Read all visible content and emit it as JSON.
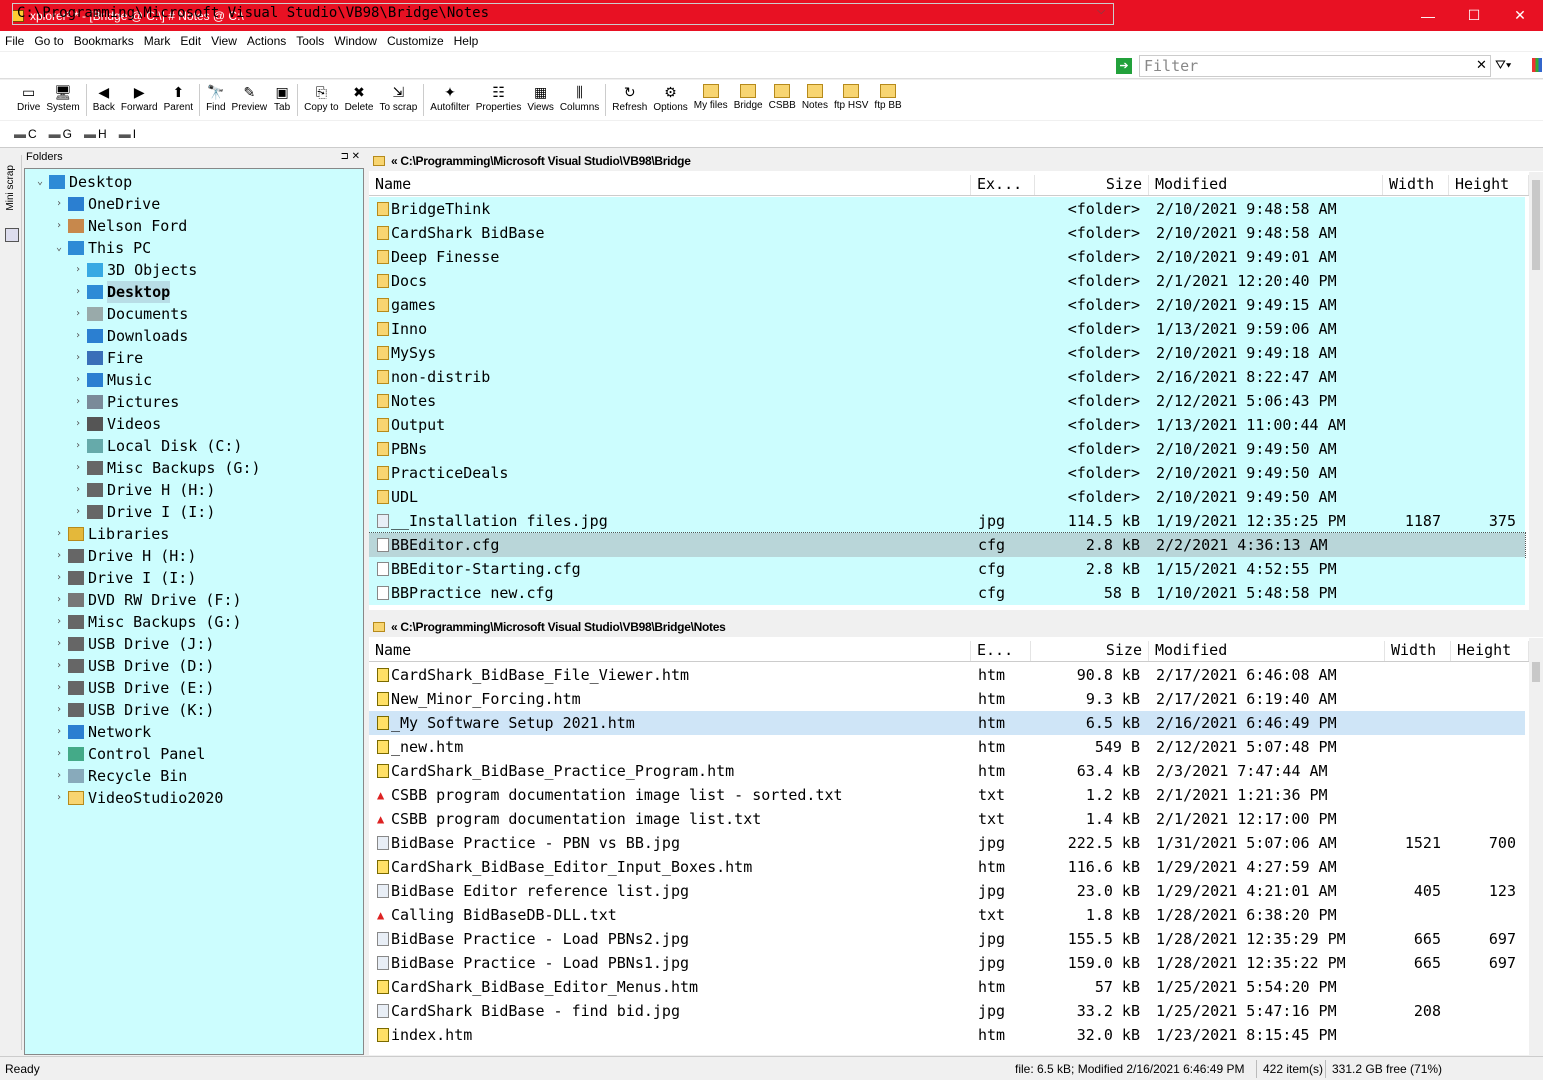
{
  "window": {
    "title": "xplorer² * - [Bridge @ C:\\] # Notes @ C:\\",
    "min": "—",
    "max": "☐",
    "close": "✕"
  },
  "menu": [
    "File",
    "Go to",
    "Bookmarks",
    "Mark",
    "Edit",
    "View",
    "Actions",
    "Tools",
    "Window",
    "Customize",
    "Help"
  ],
  "address": {
    "path": "C:\\Programming\\Microsoft Visual Studio\\VB98\\Bridge\\Notes",
    "filter_placeholder": "Filter"
  },
  "toolbar": [
    {
      "label": "Drive",
      "icon": "drive-icon",
      "glyph": "▭"
    },
    {
      "label": "System",
      "icon": "system-icon",
      "glyph": "🖥"
    },
    {
      "sep": true
    },
    {
      "label": "Back",
      "icon": "back-icon",
      "glyph": "◀"
    },
    {
      "label": "Forward",
      "icon": "forward-icon",
      "glyph": "▶"
    },
    {
      "label": "Parent",
      "icon": "parent-icon",
      "glyph": "⬆"
    },
    {
      "sep": true
    },
    {
      "label": "Find",
      "icon": "find-icon",
      "glyph": "🔭"
    },
    {
      "label": "Preview",
      "icon": "preview-icon",
      "glyph": "✎"
    },
    {
      "label": "Tab",
      "icon": "tab-icon",
      "glyph": "▣"
    },
    {
      "sep": true
    },
    {
      "label": "Copy to",
      "icon": "copy-to-icon",
      "glyph": "⎘"
    },
    {
      "label": "Delete",
      "icon": "delete-icon",
      "glyph": "✖"
    },
    {
      "label": "To scrap",
      "icon": "to-scrap-icon",
      "glyph": "⇲"
    },
    {
      "sep": true
    },
    {
      "label": "Autofilter",
      "icon": "autofilter-icon",
      "glyph": "✦"
    },
    {
      "label": "Properties",
      "icon": "properties-icon",
      "glyph": "☷"
    },
    {
      "label": "Views",
      "icon": "views-icon",
      "glyph": "▦"
    },
    {
      "label": "Columns",
      "icon": "columns-icon",
      "glyph": "⫼"
    },
    {
      "sep": true
    },
    {
      "label": "Refresh",
      "icon": "refresh-icon",
      "glyph": "↻"
    },
    {
      "label": "Options",
      "icon": "options-icon",
      "glyph": "⚙"
    },
    {
      "label": "My files",
      "icon": "folder-icon",
      "glyph": "▬"
    },
    {
      "label": "Bridge",
      "icon": "folder-icon",
      "glyph": "▬"
    },
    {
      "label": "CSBB",
      "icon": "folder-icon",
      "glyph": "▬"
    },
    {
      "label": "Notes",
      "icon": "folder-icon",
      "glyph": "▬"
    },
    {
      "label": "ftp HSV",
      "icon": "ftp-folder-icon",
      "glyph": "▬"
    },
    {
      "label": "ftp BB",
      "icon": "ftp-folder-icon",
      "glyph": "▬"
    }
  ],
  "drives": [
    "C",
    "G",
    "H",
    "I"
  ],
  "miniscrap": "Mini scrap",
  "folders_label": "Folders",
  "tree": [
    {
      "label": "Desktop",
      "level": 0,
      "exp": "open",
      "icon": "desktop-icon",
      "color": "#2e8bd6"
    },
    {
      "label": "OneDrive",
      "level": 1,
      "exp": "closed",
      "icon": "cloud-icon",
      "color": "#2b7fd1"
    },
    {
      "label": "Nelson Ford",
      "level": 1,
      "exp": "closed",
      "icon": "user-icon",
      "color": "#c7884c"
    },
    {
      "label": "This PC",
      "level": 1,
      "exp": "open",
      "icon": "computer-icon",
      "color": "#2e8bd6"
    },
    {
      "label": "3D Objects",
      "level": 2,
      "exp": "closed",
      "icon": "cube-icon",
      "color": "#38a9e3"
    },
    {
      "label": "Desktop",
      "level": 2,
      "exp": "closed",
      "icon": "desktop-icon",
      "color": "#2e8bd6",
      "sel": true
    },
    {
      "label": "Documents",
      "level": 2,
      "exp": "closed",
      "icon": "documents-icon",
      "color": "#9aa"
    },
    {
      "label": "Downloads",
      "level": 2,
      "exp": "closed",
      "icon": "download-icon",
      "color": "#2b7fd1"
    },
    {
      "label": "Fire",
      "level": 2,
      "exp": "closed",
      "icon": "device-icon",
      "color": "#3a6fb8"
    },
    {
      "label": "Music",
      "level": 2,
      "exp": "closed",
      "icon": "music-icon",
      "color": "#2b7fd1"
    },
    {
      "label": "Pictures",
      "level": 2,
      "exp": "closed",
      "icon": "pictures-icon",
      "color": "#7a8a99"
    },
    {
      "label": "Videos",
      "level": 2,
      "exp": "closed",
      "icon": "video-icon",
      "color": "#555"
    },
    {
      "label": "Local Disk (C:)",
      "level": 2,
      "exp": "closed",
      "icon": "disk-icon",
      "color": "#6aa"
    },
    {
      "label": "Misc Backups (G:)",
      "level": 2,
      "exp": "closed",
      "icon": "drive-icon",
      "color": "#666"
    },
    {
      "label": "Drive H (H:)",
      "level": 2,
      "exp": "closed",
      "icon": "drive-icon",
      "color": "#666"
    },
    {
      "label": "Drive I (I:)",
      "level": 2,
      "exp": "closed",
      "icon": "drive-icon",
      "color": "#666"
    },
    {
      "label": "Libraries",
      "level": 1,
      "exp": "closed",
      "icon": "libraries-icon",
      "color": "#e4b83a"
    },
    {
      "label": "Drive H (H:)",
      "level": 1,
      "exp": "closed",
      "icon": "drive-icon",
      "color": "#666"
    },
    {
      "label": "Drive I (I:)",
      "level": 1,
      "exp": "closed",
      "icon": "drive-icon",
      "color": "#666"
    },
    {
      "label": "DVD RW Drive (F:)",
      "level": 1,
      "exp": "closed",
      "icon": "dvd-icon",
      "color": "#777"
    },
    {
      "label": "Misc Backups (G:)",
      "level": 1,
      "exp": "closed",
      "icon": "drive-icon",
      "color": "#666"
    },
    {
      "label": "USB Drive (J:)",
      "level": 1,
      "exp": "closed",
      "icon": "usb-icon",
      "color": "#666"
    },
    {
      "label": "USB Drive (D:)",
      "level": 1,
      "exp": "closed",
      "icon": "usb-icon",
      "color": "#666"
    },
    {
      "label": "USB Drive (E:)",
      "level": 1,
      "exp": "closed",
      "icon": "usb-icon",
      "color": "#666"
    },
    {
      "label": "USB Drive (K:)",
      "level": 1,
      "exp": "closed",
      "icon": "usb-icon",
      "color": "#666"
    },
    {
      "label": "Network",
      "level": 1,
      "exp": "closed",
      "icon": "network-icon",
      "color": "#2b7fd1"
    },
    {
      "label": "Control Panel",
      "level": 1,
      "exp": "closed",
      "icon": "control-panel-icon",
      "color": "#4a8"
    },
    {
      "label": "Recycle Bin",
      "level": 1,
      "exp": "closed",
      "icon": "recycle-bin-icon",
      "color": "#8ab"
    },
    {
      "label": "VideoStudio2020",
      "level": 1,
      "exp": "closed",
      "icon": "folder-icon",
      "color": "#f8d571"
    }
  ],
  "pane1": {
    "path": "« C:\\Programming\\Microsoft Visual Studio\\VB98\\Bridge",
    "columns": {
      "name": "Name",
      "ext": "Ex...",
      "size": "Size",
      "modified": "Modified",
      "width": "Width",
      "height": "Height"
    },
    "rows": [
      {
        "name": "BridgeThink",
        "ext": "",
        "size": "<folder>",
        "mod": "2/10/2021 9:48:58 AM",
        "w": "",
        "h": "",
        "type": "folder"
      },
      {
        "name": "CardShark BidBase",
        "ext": "",
        "size": "<folder>",
        "mod": "2/10/2021 9:48:58 AM",
        "w": "",
        "h": "",
        "type": "folder"
      },
      {
        "name": "Deep Finesse",
        "ext": "",
        "size": "<folder>",
        "mod": "2/10/2021 9:49:01 AM",
        "w": "",
        "h": "",
        "type": "folder"
      },
      {
        "name": "Docs",
        "ext": "",
        "size": "<folder>",
        "mod": "2/1/2021 12:20:40 PM",
        "w": "",
        "h": "",
        "type": "folder"
      },
      {
        "name": "games",
        "ext": "",
        "size": "<folder>",
        "mod": "2/10/2021 9:49:15 AM",
        "w": "",
        "h": "",
        "type": "folder"
      },
      {
        "name": "Inno",
        "ext": "",
        "size": "<folder>",
        "mod": "1/13/2021 9:59:06 AM",
        "w": "",
        "h": "",
        "type": "folder"
      },
      {
        "name": "MySys",
        "ext": "",
        "size": "<folder>",
        "mod": "2/10/2021 9:49:18 AM",
        "w": "",
        "h": "",
        "type": "folder"
      },
      {
        "name": "non-distrib",
        "ext": "",
        "size": "<folder>",
        "mod": "2/16/2021 8:22:47 AM",
        "w": "",
        "h": "",
        "type": "folder"
      },
      {
        "name": "Notes",
        "ext": "",
        "size": "<folder>",
        "mod": "2/12/2021 5:06:43 PM",
        "w": "",
        "h": "",
        "type": "folder"
      },
      {
        "name": "Output",
        "ext": "",
        "size": "<folder>",
        "mod": "1/13/2021 11:00:44 AM",
        "w": "",
        "h": "",
        "type": "folder"
      },
      {
        "name": "PBNs",
        "ext": "",
        "size": "<folder>",
        "mod": "2/10/2021 9:49:50 AM",
        "w": "",
        "h": "",
        "type": "folder"
      },
      {
        "name": "PracticeDeals",
        "ext": "",
        "size": "<folder>",
        "mod": "2/10/2021 9:49:50 AM",
        "w": "",
        "h": "",
        "type": "folder"
      },
      {
        "name": "UDL",
        "ext": "",
        "size": "<folder>",
        "mod": "2/10/2021 9:49:50 AM",
        "w": "",
        "h": "",
        "type": "folder"
      },
      {
        "name": "__Installation files.jpg",
        "ext": "jpg",
        "size": "114.5 kB",
        "mod": "1/19/2021 12:35:25 PM",
        "w": "1187",
        "h": "375",
        "type": "jpg"
      },
      {
        "name": "BBEditor.cfg",
        "ext": "cfg",
        "size": "2.8 kB",
        "mod": "2/2/2021 4:36:13 AM",
        "w": "",
        "h": "",
        "type": "cfg",
        "sel": true
      },
      {
        "name": "BBEditor-Starting.cfg",
        "ext": "cfg",
        "size": "2.8 kB",
        "mod": "1/15/2021 4:52:55 PM",
        "w": "",
        "h": "",
        "type": "cfg"
      },
      {
        "name": "BBPractice new.cfg",
        "ext": "cfg",
        "size": "58 B",
        "mod": "1/10/2021 5:48:58 PM",
        "w": "",
        "h": "",
        "type": "cfg"
      }
    ]
  },
  "pane2": {
    "path": "« C:\\Programming\\Microsoft Visual Studio\\VB98\\Bridge\\Notes",
    "columns": {
      "name": "Name",
      "ext": "E...",
      "size": "Size",
      "modified": "Modified",
      "width": "Width",
      "height": "Height"
    },
    "rows": [
      {
        "name": "CardShark_BidBase_File_Viewer.htm",
        "ext": "htm",
        "size": "90.8 kB",
        "mod": "2/17/2021 6:46:08 AM",
        "w": "",
        "h": "",
        "type": "htm"
      },
      {
        "name": "New_Minor_Forcing.htm",
        "ext": "htm",
        "size": "9.3 kB",
        "mod": "2/17/2021 6:19:40 AM",
        "w": "",
        "h": "",
        "type": "htm"
      },
      {
        "name": "_My Software Setup 2021.htm",
        "ext": "htm",
        "size": "6.5 kB",
        "mod": "2/16/2021 6:46:49 PM",
        "w": "",
        "h": "",
        "type": "htm",
        "sel": true
      },
      {
        "name": "_new.htm",
        "ext": "htm",
        "size": "549 B",
        "mod": "2/12/2021 5:07:48 PM",
        "w": "",
        "h": "",
        "type": "htm"
      },
      {
        "name": "CardShark_BidBase_Practice_Program.htm",
        "ext": "htm",
        "size": "63.4 kB",
        "mod": "2/3/2021 7:47:44 AM",
        "w": "",
        "h": "",
        "type": "htm"
      },
      {
        "name": "CSBB program documentation image list - sorted.txt",
        "ext": "txt",
        "size": "1.2 kB",
        "mod": "2/1/2021 1:21:36 PM",
        "w": "",
        "h": "",
        "type": "txt"
      },
      {
        "name": "CSBB program documentation image list.txt",
        "ext": "txt",
        "size": "1.4 kB",
        "mod": "2/1/2021 12:17:00 PM",
        "w": "",
        "h": "",
        "type": "txt"
      },
      {
        "name": "BidBase Practice - PBN vs BB.jpg",
        "ext": "jpg",
        "size": "222.5 kB",
        "mod": "1/31/2021 5:07:06 AM",
        "w": "1521",
        "h": "700",
        "type": "jpg"
      },
      {
        "name": "CardShark_BidBase_Editor_Input_Boxes.htm",
        "ext": "htm",
        "size": "116.6 kB",
        "mod": "1/29/2021 4:27:59 AM",
        "w": "",
        "h": "",
        "type": "htm"
      },
      {
        "name": "BidBase Editor reference list.jpg",
        "ext": "jpg",
        "size": "23.0 kB",
        "mod": "1/29/2021 4:21:01 AM",
        "w": "405",
        "h": "123",
        "type": "jpg"
      },
      {
        "name": "Calling BidBaseDB-DLL.txt",
        "ext": "txt",
        "size": "1.8 kB",
        "mod": "1/28/2021 6:38:20 PM",
        "w": "",
        "h": "",
        "type": "txt"
      },
      {
        "name": "BidBase Practice - Load PBNs2.jpg",
        "ext": "jpg",
        "size": "155.5 kB",
        "mod": "1/28/2021 12:35:29 PM",
        "w": "665",
        "h": "697",
        "type": "jpg"
      },
      {
        "name": "BidBase Practice - Load PBNs1.jpg",
        "ext": "jpg",
        "size": "159.0 kB",
        "mod": "1/28/2021 12:35:22 PM",
        "w": "665",
        "h": "697",
        "type": "jpg"
      },
      {
        "name": "CardShark_BidBase_Editor_Menus.htm",
        "ext": "htm",
        "size": "57 kB",
        "mod": "1/25/2021 5:54:20 PM",
        "w": "",
        "h": "",
        "type": "htm"
      },
      {
        "name": "CardShark BidBase - find bid.jpg",
        "ext": "jpg",
        "size": "33.2 kB",
        "mod": "1/25/2021 5:47:16 PM",
        "w": "208",
        "h": "",
        "type": "jpg"
      },
      {
        "name": "index.htm",
        "ext": "htm",
        "size": "32.0 kB",
        "mod": "1/23/2021 8:15:45 PM",
        "w": "",
        "h": "",
        "type": "htm"
      }
    ]
  },
  "status": {
    "ready": "Ready",
    "file_info": "file: 6.5 kB; Modified 2/16/2021 6:46:49 PM",
    "count": "422 item(s)",
    "free": "331.2 GB free (71%)"
  },
  "colors": {
    "title_bar": "#e81123",
    "tree_bg": "#ccfdfe",
    "folder_row_bg": "#ccfdfe",
    "selected_row": "#cfe5f7"
  }
}
